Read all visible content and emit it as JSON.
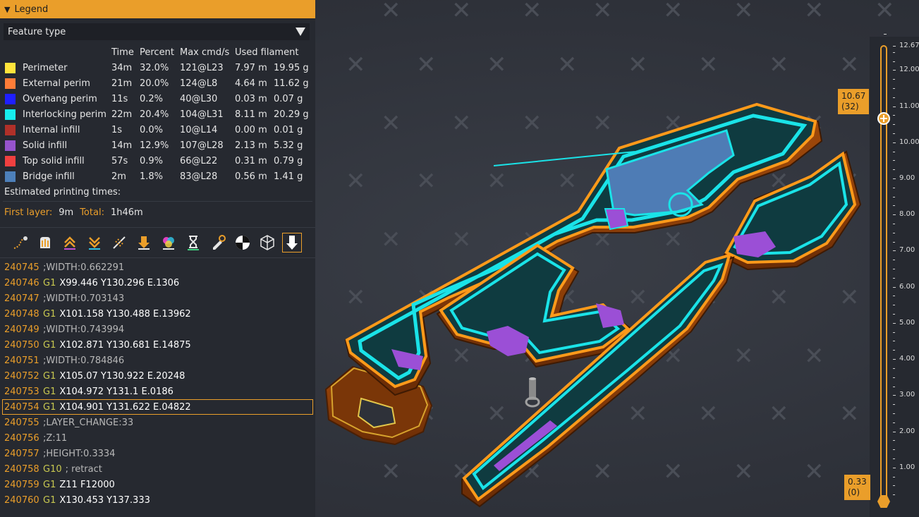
{
  "legend": {
    "title": "Legend",
    "view_type": "Feature type",
    "columns": [
      "Time",
      "Percent",
      "Max cmd/s",
      "Used filament"
    ],
    "rows": [
      {
        "name": "Perimeter",
        "color": "#ffe43b",
        "time": "34m",
        "percent": "32.0%",
        "max": "121@L23",
        "length": "7.97 m",
        "weight": "19.95 g"
      },
      {
        "name": "External perim",
        "color": "#ff7d38",
        "time": "21m",
        "percent": "20.0%",
        "max": "124@L8",
        "length": "4.64 m",
        "weight": "11.62 g"
      },
      {
        "name": "Overhang perim",
        "color": "#1f1fff",
        "time": "11s",
        "percent": "0.2%",
        "max": "40@L30",
        "length": "0.03 m",
        "weight": "0.07 g"
      },
      {
        "name": "Interlocking perim",
        "color": "#17eded",
        "time": "22m",
        "percent": "20.4%",
        "max": "104@L31",
        "length": "8.11 m",
        "weight": "20.29 g"
      },
      {
        "name": "Internal infill",
        "color": "#b03029",
        "time": "1s",
        "percent": "0.0%",
        "max": "10@L14",
        "length": "0.00 m",
        "weight": "0.01 g"
      },
      {
        "name": "Solid infill",
        "color": "#9654cc",
        "time": "14m",
        "percent": "12.9%",
        "max": "107@L28",
        "length": "2.13 m",
        "weight": "5.32 g"
      },
      {
        "name": "Top solid infill",
        "color": "#f04040",
        "time": "57s",
        "percent": "0.9%",
        "max": "66@L22",
        "length": "0.31 m",
        "weight": "0.79 g"
      },
      {
        "name": "Bridge infill",
        "color": "#4d80ba",
        "time": "2m",
        "percent": "1.8%",
        "max": "83@L28",
        "length": "0.56 m",
        "weight": "1.41 g"
      }
    ],
    "estimated_title": "Estimated printing times:",
    "first_layer_label": "First layer:",
    "first_layer_value": "9m",
    "total_label": "Total:",
    "total_value": "1h46m"
  },
  "toolbar_icons": [
    "travel-icon",
    "wipe-icon",
    "retractions-icon",
    "deretractions-icon",
    "seams-icon",
    "tool-changes-icon",
    "color-changes-icon",
    "pause-prints-icon",
    "custom-gcodes-icon",
    "center-of-gravity-icon",
    "shells-icon",
    "tool-marker-icon"
  ],
  "gcode": [
    {
      "line": "240745",
      "cmd": "",
      "args": "",
      "comment": ";WIDTH:0.662291"
    },
    {
      "line": "240746",
      "cmd": "G1",
      "args": "X99.446 Y130.296 E.1306",
      "comment": ""
    },
    {
      "line": "240747",
      "cmd": "",
      "args": "",
      "comment": ";WIDTH:0.703143"
    },
    {
      "line": "240748",
      "cmd": "G1",
      "args": "X101.158 Y130.488 E.13962",
      "comment": ""
    },
    {
      "line": "240749",
      "cmd": "",
      "args": "",
      "comment": ";WIDTH:0.743994"
    },
    {
      "line": "240750",
      "cmd": "G1",
      "args": "X102.871 Y130.681 E.14875",
      "comment": ""
    },
    {
      "line": "240751",
      "cmd": "",
      "args": "",
      "comment": ";WIDTH:0.784846"
    },
    {
      "line": "240752",
      "cmd": "G1",
      "args": "X105.07 Y130.922 E.20248",
      "comment": ""
    },
    {
      "line": "240753",
      "cmd": "G1",
      "args": "X104.972 Y131.1 E.0186",
      "comment": ""
    },
    {
      "line": "240754",
      "cmd": "G1",
      "args": "X104.901 Y131.622 E.04822",
      "comment": ""
    },
    {
      "line": "240755",
      "cmd": "",
      "args": "",
      "comment": ";LAYER_CHANGE:33"
    },
    {
      "line": "240756",
      "cmd": "",
      "args": "",
      "comment": ";Z:11"
    },
    {
      "line": "240757",
      "cmd": "",
      "args": "",
      "comment": ";HEIGHT:0.3334"
    },
    {
      "line": "240758",
      "cmd": "G10",
      "args": "",
      "comment": "; retract"
    },
    {
      "line": "240759",
      "cmd": "G1",
      "args": "Z11 F12000",
      "comment": ""
    },
    {
      "line": "240760",
      "cmd": "G1",
      "args": "X130.453 Y137.333",
      "comment": ""
    }
  ],
  "layer_slider": {
    "max_label": "12.67",
    "ticks": [
      "12.00",
      "11.00",
      "10.00",
      "9.00",
      "8.00",
      "7.00",
      "6.00",
      "5.00",
      "4.00",
      "3.00",
      "2.00",
      "1.00"
    ],
    "upper_height": "10.67",
    "upper_layer": "(32)",
    "lower_height": "0.33",
    "lower_layer": "(0)"
  },
  "colors": {
    "accent": "#ea9e2a",
    "panel": "#262930",
    "viewport": "#2d3038"
  }
}
